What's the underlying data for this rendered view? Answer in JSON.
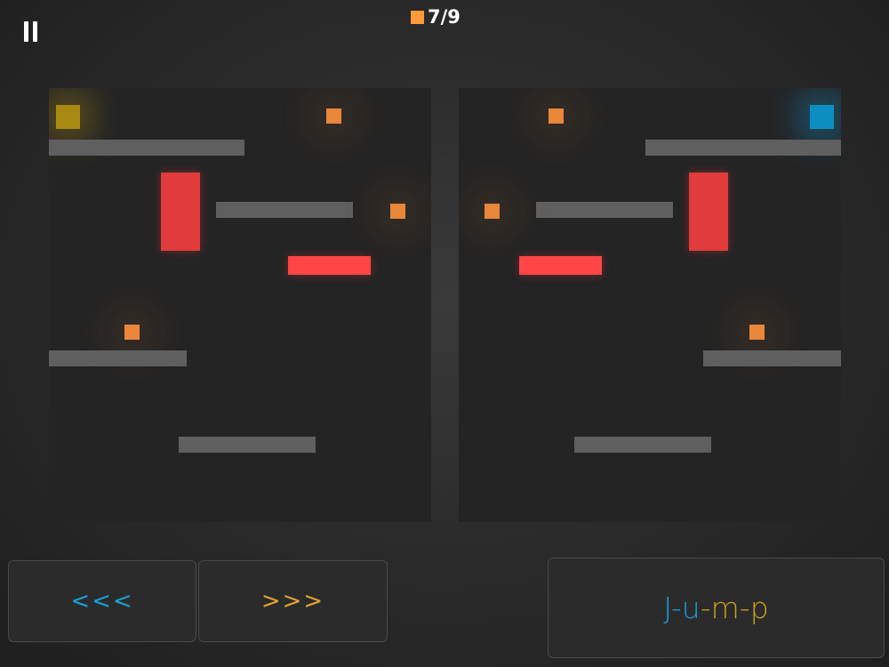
{
  "hud": {
    "pause_icon": "pause-icon",
    "coin_icon": "orange-square-icon",
    "coins_collected": "7/9"
  },
  "colors": {
    "coin": "#e8873a",
    "hazard": "#e23b3b",
    "platform": "#5f5f5f",
    "player_left": "#a88a12",
    "player_right": "#0d8ec0",
    "left_arrows": "#1a9fd6",
    "right_arrows": "#e2a232"
  },
  "controls": {
    "left_label": "<<<",
    "right_label": ">>>",
    "jump_parts": [
      "J",
      "-",
      "u",
      "-",
      "m",
      "-",
      "p"
    ]
  }
}
